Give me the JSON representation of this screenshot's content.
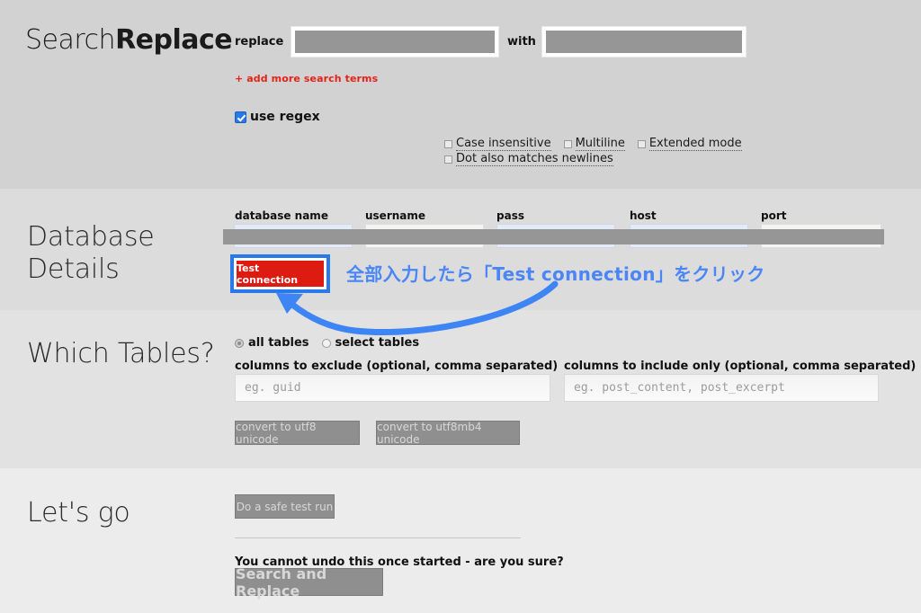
{
  "app": {
    "logo_light": "Search",
    "logo_bold": "Replace"
  },
  "search_section": {
    "replace_label": "replace",
    "with_label": "with",
    "search_value": "",
    "replace_value": "",
    "add_more_link": "+ add more search terms",
    "use_regex_label": "use regex",
    "use_regex_checked": true,
    "regex_options": [
      {
        "label": "Case insensitive",
        "checked": false
      },
      {
        "label": "Multiline",
        "checked": false
      },
      {
        "label": "Extended mode",
        "checked": false
      },
      {
        "label": "Dot also matches newlines",
        "checked": false
      }
    ]
  },
  "database_section": {
    "title": "Database\nDetails",
    "fields": [
      {
        "label": "database name",
        "value": ""
      },
      {
        "label": "username",
        "value": ""
      },
      {
        "label": "pass",
        "value": ""
      },
      {
        "label": "host",
        "value": ""
      },
      {
        "label": "port",
        "value": ""
      }
    ],
    "test_connection_label": "Test connection"
  },
  "annotation": {
    "text": "全部入力したら「Test connection」をクリック",
    "color": "#4a86f7",
    "highlight_color": "#2a79e8"
  },
  "tables_section": {
    "title": "Which Tables?",
    "radios": [
      {
        "label": "all tables",
        "selected": true
      },
      {
        "label": "select tables",
        "selected": false
      }
    ],
    "exclude_label": "columns to exclude (optional, comma separated)",
    "exclude_placeholder": "eg. guid",
    "exclude_value": "",
    "include_label": "columns to include only (optional, comma separated)",
    "include_placeholder": "eg. post_content, post_excerpt",
    "include_value": "",
    "convert_utf8_label": "convert to utf8 unicode",
    "convert_utf8mb4_label": "convert to utf8mb4 unicode"
  },
  "go_section": {
    "title": "Let's go",
    "safe_test_run_label": "Do a safe test run",
    "warning_text": "You cannot undo this once started - are you sure?",
    "search_replace_label": "Search and Replace"
  }
}
